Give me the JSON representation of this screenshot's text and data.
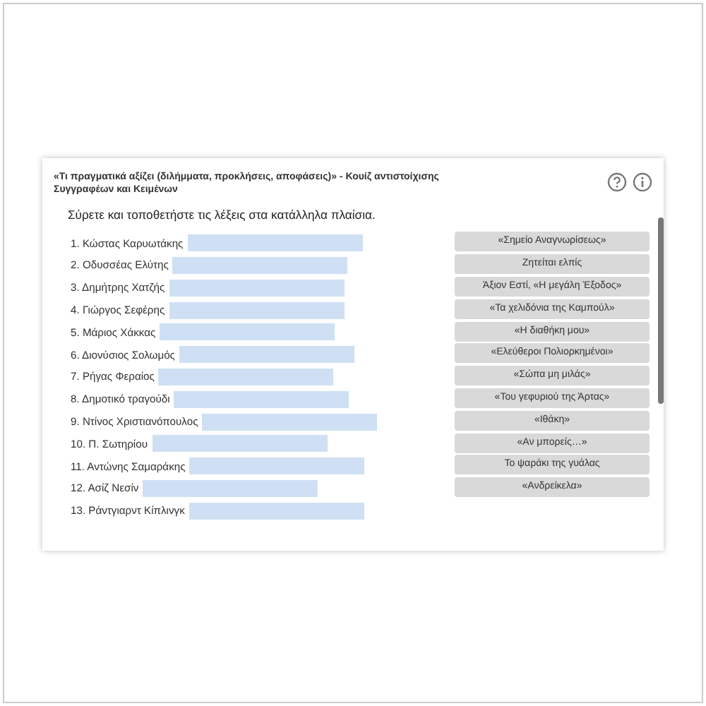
{
  "header": {
    "title": "«Τι πραγματικά αξίζει (διλήμματα, προκλήσεις, αποφάσεις)» - Κουίζ αντιστοίχισης Συγγραφέων και Κειμένων"
  },
  "instruction": "Σύρετε και τοποθετήστε τις λέξεις στα κατάλληλα πλαίσια.",
  "targets": [
    "1. Κώστας Καρυωτάκης",
    "2. Οδυσσέας Ελύτης",
    "3. Δημήτρης Χατζής",
    "4. Γιώργος Σεφέρης",
    "5. Μάριος Χάκκας",
    "6. Διονύσιος Σολωμός",
    "7. Ρήγας Φεραίος",
    "8. Δημοτικό τραγούδι",
    "9. Ντίνος Χριστιανόπουλος",
    "10. Π. Σωτηρίου",
    "11. Αντώνης Σαμαράκης",
    "12. Ασίζ Νεσίν",
    "13. Ράντγιαρντ Κίπλινγκ"
  ],
  "words": [
    "«Σημείο Αναγνωρίσεως»",
    "Ζητείται ελπίς",
    "Άξιον Εστί, «Η μεγάλη Έξοδος»",
    "«Τα χελιδόνια της Καμπούλ»",
    "«Η διαθήκη μου»",
    "«Ελεύθεροι Πολιορκημένοι»",
    "«Σώπα μη μιλάς»",
    "«Του γεφυριού της Άρτας»",
    "«Ιθάκη»",
    "«Αν μπορείς…»",
    "Το ψαράκι της γυάλας",
    "«Ανδρείκελα»"
  ]
}
